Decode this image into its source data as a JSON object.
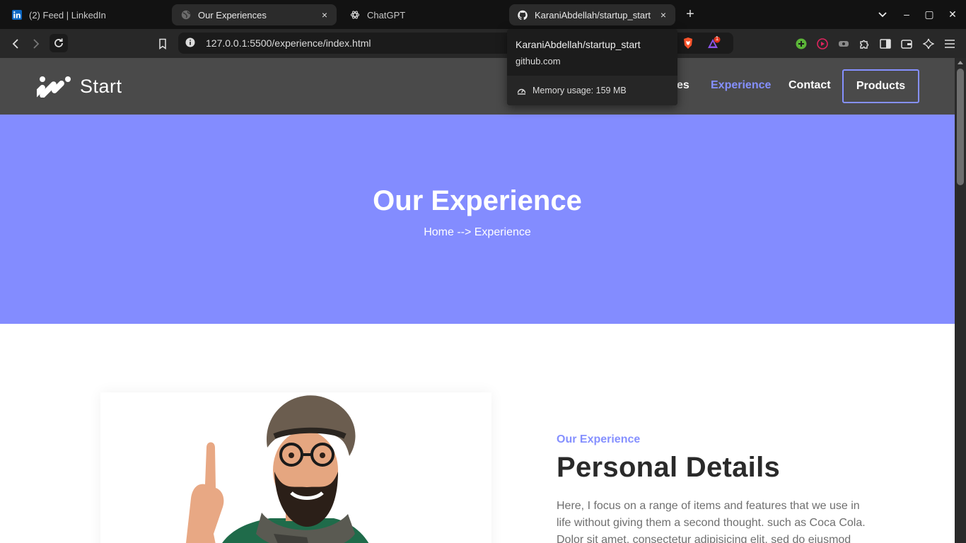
{
  "browser": {
    "tabs": [
      {
        "title": "(2) Feed | LinkedIn",
        "favicon": "linkedin-icon"
      },
      {
        "title": "Our Experiences",
        "favicon": "globe-icon",
        "active": true,
        "close": "×"
      },
      {
        "title": "ChatGPT",
        "favicon": "chatgpt-icon"
      },
      {
        "title": "KaraniAbdellah/startup_start",
        "favicon": "github-icon",
        "active": true,
        "close": "×"
      }
    ],
    "new_tab": "+",
    "window_controls": {
      "minimize": "–",
      "maximize": "▢",
      "close": "✕"
    },
    "url": "127.0.0.1:5500/experience/index.html",
    "hover_card": {
      "title": "KaraniAbdellah/startup_start",
      "domain": "github.com",
      "memory": "Memory usage: 159 MB"
    },
    "brave_rewards_badge": "1",
    "colors": {
      "tab_strip": "#121212",
      "toolbar": "#282828",
      "omnibox": "#1b1b1b"
    }
  },
  "site": {
    "brand": "Start",
    "nav": [
      {
        "label": "es"
      },
      {
        "label": "Experience",
        "current": true
      },
      {
        "label": "Contact"
      }
    ],
    "cta": "Products",
    "hero": {
      "title": "Our Experience",
      "breadcrumb": "Home --> Experience"
    },
    "about": {
      "eyebrow": "Our Experience",
      "heading": "Personal Details",
      "body_line1": "Here, I focus on a range of items and features that we use in",
      "body_line2": "life without giving them a second thought. such as Coca Cola.",
      "body_line3": "Dolor sit amet, consectetur adipisicing elit, sed do eiusmod"
    },
    "colors": {
      "accent": "#838cff",
      "header": "#4a4a4a",
      "heading": "#2a2a2a",
      "body": "#6f6f6f"
    }
  }
}
